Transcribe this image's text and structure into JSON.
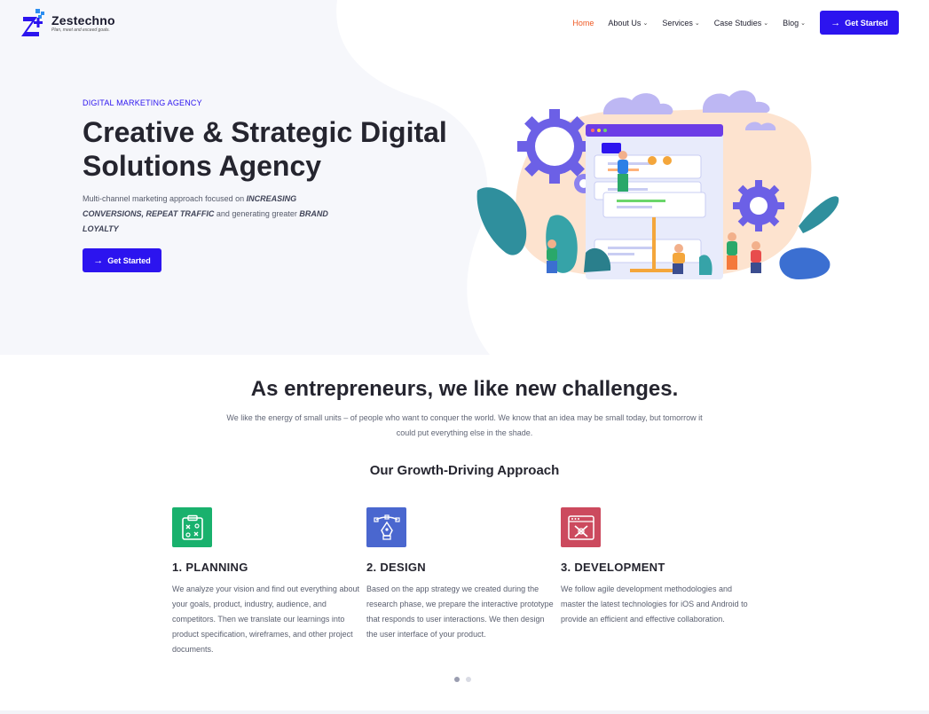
{
  "brand": {
    "name": "Zestechno",
    "tagline": "Plan, meet and exceed goals."
  },
  "nav": {
    "items": [
      {
        "label": "Home",
        "active": true,
        "has_dropdown": false
      },
      {
        "label": "About Us",
        "active": false,
        "has_dropdown": true
      },
      {
        "label": "Services",
        "active": false,
        "has_dropdown": true
      },
      {
        "label": "Case Studies",
        "active": false,
        "has_dropdown": true
      },
      {
        "label": "Blog",
        "active": false,
        "has_dropdown": true
      }
    ],
    "cta_label": "Get Started"
  },
  "hero": {
    "tag": "DIGITAL MARKETING AGENCY",
    "title_line1": "Creative & Strategic Digital",
    "title_line2": "Solutions Agency",
    "desc_part1": "Multi-channel marketing approach focused on ",
    "desc_bold1": "INCREASING CONVERSIONS, REPEAT TRAFFIC",
    "desc_part2": " and generating greater ",
    "desc_bold2": "BRAND LOYALTY",
    "cta_label": "Get Started"
  },
  "intro": {
    "title": "As entrepreneurs, we like new challenges.",
    "description": "We like the energy of small units – of people who want to conquer the world. We know that an idea may be small today, but tomorrow it could put everything else in the shade.",
    "subtitle": "Our Growth-Driving Approach"
  },
  "steps": [
    {
      "title": "1. PLANNING",
      "text": "We analyze your vision and find out everything about your goals, product, industry, audience, and competitors. Then we translate our learnings into product specification, wireframes, and other project documents.",
      "icon": "clipboard-strategy-icon",
      "color": "#19b16d"
    },
    {
      "title": "2. DESIGN",
      "text": "Based on the app strategy we created during the research phase, we prepare the interactive prototype that responds to user interactions. We then design the user interface of your product.",
      "icon": "pen-tool-icon",
      "color": "#4a67cf"
    },
    {
      "title": "3. DEVELOPMENT",
      "text": "We follow agile development methodologies and master the latest technologies for iOS and Android to provide an efficient and effective collaboration.",
      "icon": "browser-tools-icon",
      "color": "#cc4a5e"
    }
  ],
  "carousel": {
    "pages": 2,
    "active": 1
  },
  "colors": {
    "primary": "#2c14ef",
    "nav_active": "#ef5a24",
    "heading": "#25252f"
  }
}
